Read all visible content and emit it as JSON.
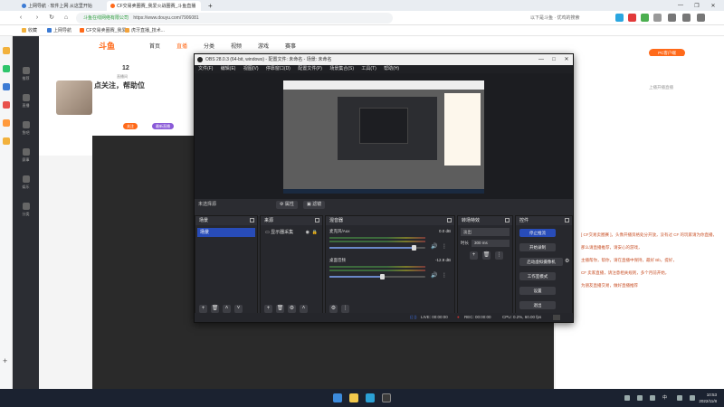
{
  "browser": {
    "tabs": [
      {
        "label": "上网导航 · 软件上网 从这里开始",
        "color": "#3c7bd4"
      },
      {
        "label": "CF交易卖圈赛_我爱火战圈赛_斗鱼直播",
        "color": "#ff6a1a"
      }
    ],
    "new_tab": "+",
    "url": "https://www.douyu.com/7906081",
    "security_label": "斗鱼在线网络有限公司",
    "omnibox_hint": "以下是斗鱼 · 优鸡的搜索",
    "window_controls": [
      "—",
      "❐",
      "✕"
    ],
    "bookmarks": [
      {
        "label": "收藏",
        "color": "#f2b13c"
      },
      {
        "label": "上网导航",
        "color": "#3c7bd4"
      },
      {
        "label": "CF交易卖圈赛_我爱...",
        "color": "#ff6a1a"
      },
      {
        "label": "虎牙直播_技术...",
        "color": "#f3a33a"
      }
    ]
  },
  "appside": {
    "icons": [
      "app-icon-1",
      "app-icon-2",
      "app-icon-3",
      "app-icon-4",
      "app-icon-5",
      "app-icon-6"
    ],
    "add_label": "+"
  },
  "douyu": {
    "logo": "斗鱼",
    "menu": [
      "首页",
      "直播",
      "分类",
      "视频",
      "游戏",
      "赛事"
    ],
    "active_menu": "直播",
    "left_nav": [
      "推荐",
      "直播",
      "鱼吧",
      "赛事",
      "娱乐",
      "分类"
    ],
    "room_title": "点关注，帮助位",
    "room_stat": "12",
    "room_stat_label": "直播间",
    "pill_follow": "关注",
    "pill_hot": "最新直播",
    "pc_download": "PC客户端",
    "right_hint": "上播开播直播",
    "notice_lines": [
      "[ CF交易卖圈赛 ]，头像开播资格处分开放，没有过 CF 的玩家请为你直播，",
      "那么请直播推荐，请安心的游戏，",
      "主播帮你，帮你，请在直播中保持，最好 Bb，提好，",
      "CF 卖家直播，请注意相关规则，多个月前开始，",
      "为朋友直播交易，做好直播推荐"
    ]
  },
  "obs": {
    "title": "OBS 28.0.3 (64-bit, windows) - 配置文件: 未命名 - 场景: 未命名",
    "menu": [
      "文件(F)",
      "编辑(E)",
      "视图(V)",
      "停靠窗口(D)",
      "配置文件(P)",
      "场景集合(S)",
      "工具(T)",
      "帮助(H)"
    ],
    "toolbar_scene_label": "未选择源",
    "toolbar_props": "属性",
    "toolbar_filters": "滤镜",
    "docks": {
      "scenes": {
        "title": "场景",
        "items": [
          "场景"
        ]
      },
      "sources": {
        "title": "来源",
        "items": [
          "显示器采集"
        ]
      },
      "mixer": {
        "title": "混音器",
        "channels": [
          {
            "name": "麦克风/Aux",
            "db": "0.0 dB",
            "level": 0.88
          },
          {
            "name": "桌面音频",
            "db": "-12.9 dB",
            "level": 0.55
          }
        ]
      },
      "transitions": {
        "title": "转场特效",
        "type": "淡出",
        "duration_label": "时长",
        "duration": "300 ms"
      },
      "controls": {
        "title": "控件",
        "buttons": [
          "停止推流",
          "开始录制",
          "启动虚拟摄像机",
          "工作室模式",
          "设置",
          "退出"
        ]
      }
    },
    "status": {
      "live": "LIVE: 00:00:00",
      "rec": "REC: 00:00:00",
      "cpu": "CPU: 0.2%, 60.00 fps"
    }
  },
  "taskbar": {
    "apps": [
      "windows-icon",
      "search-icon",
      "file-explorer-icon",
      "edge-icon",
      "obs-icon"
    ],
    "time": "10:53",
    "date": "2022/11/8",
    "ime": "中"
  }
}
